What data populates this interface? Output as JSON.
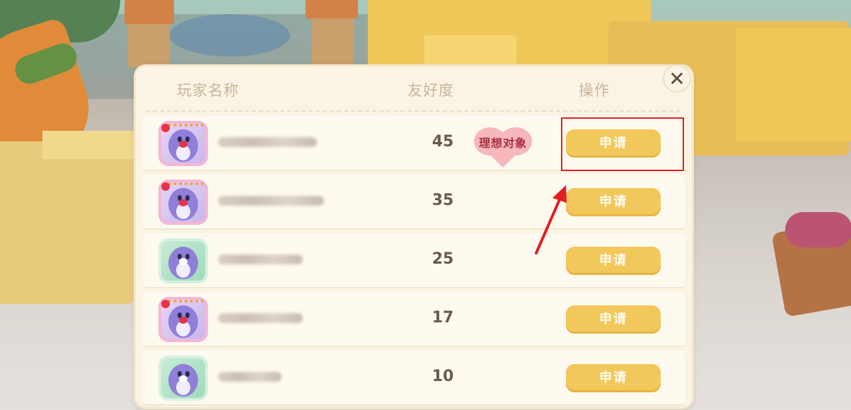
{
  "dialog": {
    "headers": {
      "player_name": "玩家名称",
      "friendship": "友好度",
      "action": "操作"
    },
    "close_symbol": "✕",
    "rows": [
      {
        "friendship": "45",
        "badge": "理想对象",
        "button": "申请",
        "avatar": "purple-seal-avatar"
      },
      {
        "friendship": "35",
        "badge": "",
        "button": "申请",
        "avatar": "purple-seal-avatar"
      },
      {
        "friendship": "25",
        "badge": "",
        "button": "申请",
        "avatar": "green-seal-avatar"
      },
      {
        "friendship": "17",
        "badge": "",
        "button": "申请",
        "avatar": "purple-seal-avatar"
      },
      {
        "friendship": "10",
        "badge": "",
        "button": "申请",
        "avatar": "green-seal-avatar"
      }
    ]
  },
  "annotation": {
    "color": "#e02020"
  },
  "colors": {
    "button": "#f2c85c",
    "panel": "#fbf4e4",
    "badge_heart": "#f6b7bd",
    "badge_text": "#a8303f"
  }
}
